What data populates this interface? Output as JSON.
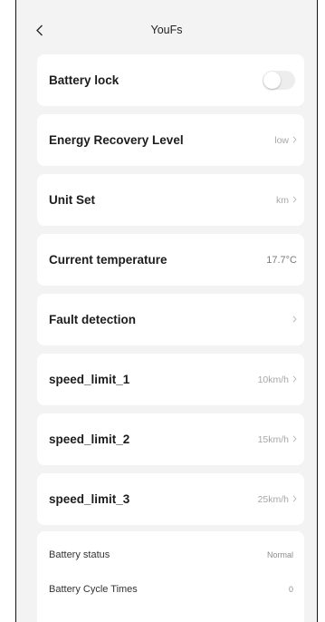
{
  "header": {
    "title": "YouFs",
    "back_icon": "chevron-left-icon"
  },
  "settings": [
    {
      "label": "Battery lock",
      "type": "toggle",
      "on": false
    },
    {
      "label": "Energy Recovery Level",
      "value": "low",
      "type": "link"
    },
    {
      "label": "Unit Set",
      "value": "km",
      "type": "link"
    },
    {
      "label": "Current temperature",
      "value": "17.7°C",
      "type": "static"
    },
    {
      "label": "Fault detection",
      "value": "",
      "type": "link"
    },
    {
      "label": "speed_limit_1",
      "value": "10km/h",
      "type": "link"
    },
    {
      "label": "speed_limit_2",
      "value": "15km/h",
      "type": "link"
    },
    {
      "label": "speed_limit_3",
      "value": "25km/h",
      "type": "link"
    }
  ],
  "status": [
    {
      "label": "Battery status",
      "value": "Normal"
    },
    {
      "label": "Battery Cycle Times",
      "value": "0"
    }
  ],
  "colors": {
    "background": "#f3f3f3",
    "card": "#ffffff",
    "muted_text": "#a8a8a8",
    "toggle_off": "#ededed"
  }
}
